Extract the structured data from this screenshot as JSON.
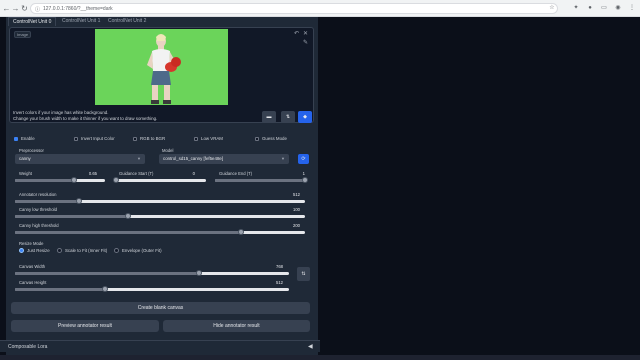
{
  "browser": {
    "url": "127.0.0.1:7860/?__theme=dark",
    "lock_symbol": "ⓘ"
  },
  "tabs": [
    "ControlNet Unit 0",
    "ControlNet Unit 1",
    "ControlNet Unit 2"
  ],
  "image_panel": {
    "label": "Image",
    "hint_line1": "Invert colors if your image has white background.",
    "hint_line2": "Change your brush width to make it thinner if you want to draw something."
  },
  "checkboxes": [
    {
      "label": "Enable",
      "checked": true
    },
    {
      "label": "Invert Input Color",
      "checked": false
    },
    {
      "label": "RGB to BGR",
      "checked": false
    },
    {
      "label": "Low VRAM",
      "checked": false
    },
    {
      "label": "Guess Mode",
      "checked": false
    }
  ],
  "preprocessor": {
    "label": "Preprocessor",
    "value": "canny"
  },
  "model": {
    "label": "Model",
    "value": "control_sd15_canny [fef5e48e]"
  },
  "sliders": {
    "weight": {
      "label": "Weight",
      "value": "0.65",
      "fraction": 0.65
    },
    "guidance_start": {
      "label": "Guidance Start (T)",
      "value": "0",
      "fraction": 0
    },
    "guidance_end": {
      "label": "Guidance End (T)",
      "value": "1",
      "fraction": 1
    },
    "annotator_resolution": {
      "label": "Annotator resolution",
      "value": "512",
      "fraction": 0.22
    },
    "canny_low": {
      "label": "Canny low threshold",
      "value": "100",
      "fraction": 0.39
    },
    "canny_high": {
      "label": "Canny high threshold",
      "value": "200",
      "fraction": 0.78
    },
    "canvas_width": {
      "label": "Canvas Width",
      "value": "768",
      "fraction": 0.67
    },
    "canvas_height": {
      "label": "Canvas Height",
      "value": "512",
      "fraction": 0.33
    }
  },
  "resize_mode": {
    "label": "Resize Mode",
    "options": [
      {
        "label": "Just Resize",
        "selected": true
      },
      {
        "label": "Scale to Fit (Inner Fit)",
        "selected": false
      },
      {
        "label": "Envelope (Outer Fit)",
        "selected": false
      }
    ]
  },
  "buttons": {
    "create_canvas": "Create blank canvas",
    "preview": "Preview annotator result",
    "hide": "Hide annotator result",
    "swap_symbol": "⇅",
    "refresh_symbol": "⟳"
  },
  "footer": {
    "label": "Composable Lora"
  },
  "colors": {
    "accent": "#3b82f6",
    "panel": "#1f2937",
    "background": "#0b0f19",
    "image_bg": "#6bd45a"
  }
}
